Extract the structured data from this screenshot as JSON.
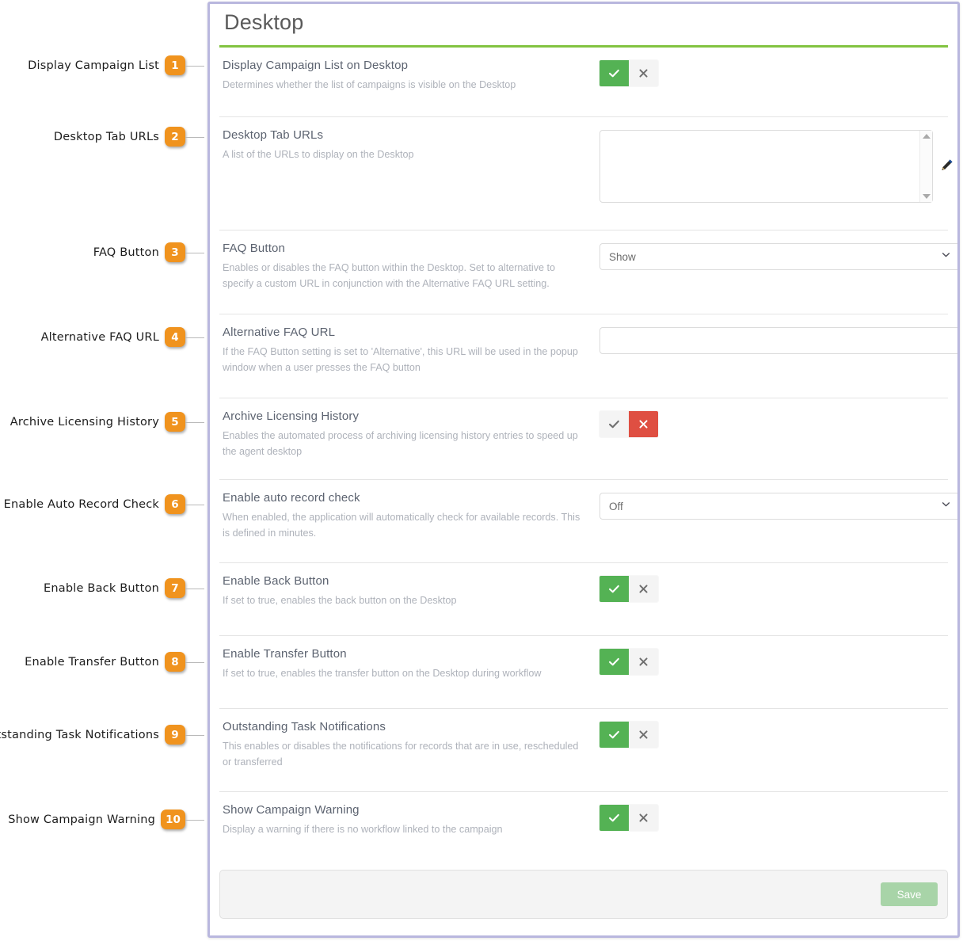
{
  "panel": {
    "title": "Desktop",
    "accent_color": "#82c341",
    "border_color": "#b9b7de"
  },
  "callout_badge_color": "#f0931e",
  "callouts": [
    {
      "number": "1",
      "label": "Display Campaign List"
    },
    {
      "number": "2",
      "label": "Desktop Tab URLs"
    },
    {
      "number": "3",
      "label": "FAQ Button"
    },
    {
      "number": "4",
      "label": "Alternative FAQ URL"
    },
    {
      "number": "5",
      "label": "Archive Licensing History"
    },
    {
      "number": "6",
      "label": "Enable Auto Record Check"
    },
    {
      "number": "7",
      "label": "Enable Back Button"
    },
    {
      "number": "8",
      "label": "Enable Transfer Button"
    },
    {
      "number": "9",
      "label": "Outstanding Task Notifications"
    },
    {
      "number": "10",
      "label": "Show Campaign Warning"
    }
  ],
  "settings": [
    {
      "name": "Display Campaign List on Desktop",
      "description": "Determines whether the list of campaigns is visible on the Desktop",
      "control": "toggle",
      "value": "yes",
      "yes_icon": "check-icon",
      "no_icon": "cross-icon"
    },
    {
      "name": "Desktop Tab URLs",
      "description": "A list of the URLs to display on the Desktop",
      "control": "textarea",
      "value": "",
      "placeholder": "",
      "edit_icon": "pencil-icon",
      "scroll_up_icon": "scroll-up-icon",
      "scroll_down_icon": "scroll-down-icon"
    },
    {
      "name": "FAQ Button",
      "description": "Enables or disables the FAQ button within the Desktop.  Set to alternative to specify a custom URL in conjunction with the Alternative FAQ URL setting.",
      "control": "select",
      "value": "Show",
      "chevron_icon": "chevron-down-icon"
    },
    {
      "name": "Alternative FAQ URL",
      "description": "If the FAQ Button setting is set to 'Alternative', this URL will be used in the popup window when a user presses the FAQ button",
      "control": "text",
      "value": "",
      "placeholder": ""
    },
    {
      "name": "Archive Licensing History",
      "description": "Enables the automated process of archiving licensing history entries to speed up the agent desktop",
      "control": "toggle",
      "value": "no",
      "yes_icon": "check-icon",
      "no_icon": "cross-icon"
    },
    {
      "name": "Enable auto record check",
      "description": "When enabled, the application will automatically check for available records. This is defined in minutes.",
      "control": "select",
      "value": "Off",
      "chevron_icon": "chevron-down-icon"
    },
    {
      "name": "Enable Back Button",
      "description": "If set to true, enables the back button on the Desktop",
      "control": "toggle",
      "value": "yes",
      "yes_icon": "check-icon",
      "no_icon": "cross-icon"
    },
    {
      "name": "Enable Transfer Button",
      "description": "If set to true, enables the transfer button on the Desktop during workflow",
      "control": "toggle",
      "value": "yes",
      "yes_icon": "check-icon",
      "no_icon": "cross-icon"
    },
    {
      "name": "Outstanding Task Notifications",
      "description": "This enables or disables the notifications for records that are in use, rescheduled or transferred",
      "control": "toggle",
      "value": "yes",
      "yes_icon": "check-icon",
      "no_icon": "cross-icon"
    },
    {
      "name": "Show Campaign Warning",
      "description": "Display a warning if there is no workflow linked to the campaign",
      "control": "toggle",
      "value": "yes",
      "yes_icon": "check-icon",
      "no_icon": "cross-icon"
    }
  ],
  "footer": {
    "save_label": "Save",
    "save_color": "#a8d4a8"
  }
}
